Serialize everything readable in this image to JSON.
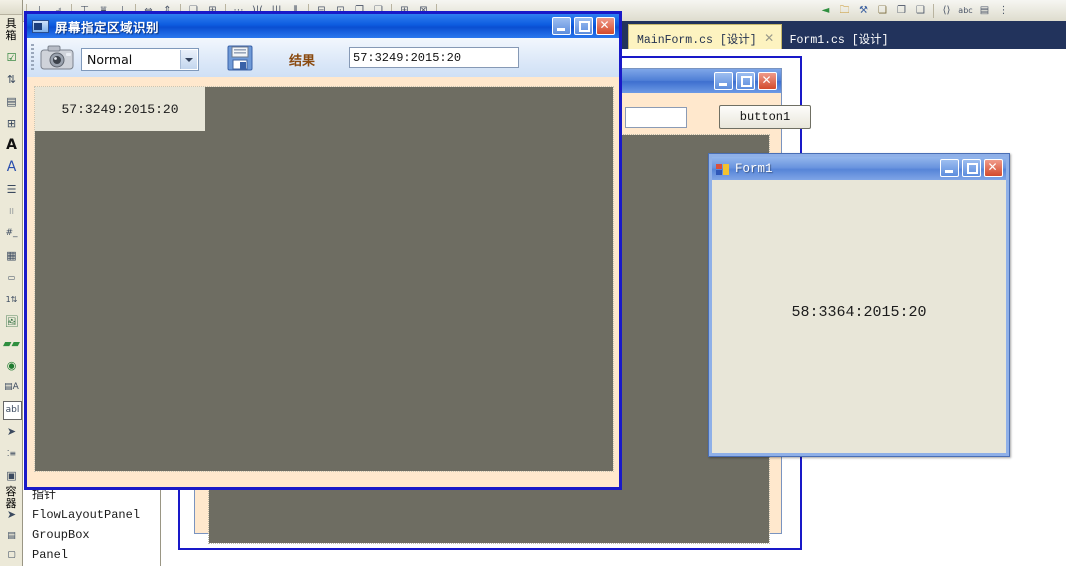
{
  "vs_toolbar": {
    "name": "visual-studio-layout-toolbar",
    "icons": [
      "align-lefts-icon",
      "align-centers-icon",
      "align-rights-icon",
      "align-tops-icon",
      "align-middles-icon",
      "align-bottoms-icon",
      "make-same-width-icon",
      "make-same-height-icon",
      "make-same-size-icon",
      "size-to-grid-icon",
      "horizontal-spacing-make-equal-icon",
      "horizontal-spacing-increase-icon",
      "horizontal-spacing-decrease-icon",
      "vertical-spacing-make-equal-icon",
      "center-horizontally-icon",
      "center-vertically-icon",
      "bring-to-front-icon",
      "send-to-back-icon",
      "tab-order-icon",
      "lock-controls-icon",
      "navigate-backward-icon",
      "open-file-icon",
      "find-in-files-icon",
      "replace-icon",
      "undo-checkout-icon",
      "redo-checkout-icon",
      "show-all-files-icon",
      "spell-check-icon",
      "properties-window-icon",
      "toolbar-overflow-icon"
    ]
  },
  "tabstrip": {
    "name": "document-tabs",
    "tabs": [
      {
        "label": "MainForm.cs [设计]",
        "active": true,
        "close_icon": "✕"
      },
      {
        "label": "Form1.cs [设计]",
        "active": false
      }
    ]
  },
  "toolbox": {
    "rail_title_top": "具箱",
    "rail_title_mid": "容器",
    "rail_icons": [
      "checkbox-control-icon",
      "numeric-updown-icon",
      "listview-control-icon",
      "datagridview-icon",
      "label-control-icon",
      "linklabel-control-icon",
      "listbox-control-icon",
      "checkedlistbox-icon",
      "maskedtextbox-icon",
      "monthcalendar-icon",
      "notifyicon-icon",
      "numericupdown-icon",
      "picturebox-icon",
      "progressbar-icon",
      "radiobutton-icon",
      "richtextbox-icon",
      "textbox-icon",
      "toolstrip-icon",
      "treeview-icon",
      "webbrowser-icon"
    ],
    "list_items": [
      {
        "label": "指针",
        "icon": "pointer-icon"
      },
      {
        "label": "FlowLayoutPanel",
        "icon": "flowlayoutpanel-icon"
      },
      {
        "label": "GroupBox",
        "icon": "groupbox-icon"
      },
      {
        "label": "Panel",
        "icon": "panel-icon"
      }
    ]
  },
  "background_designer": {
    "name": "mainform-designer-surface",
    "form": {
      "title": "",
      "min_label": "",
      "max_label": "",
      "close_label": "✕",
      "textbox_value": "",
      "button_label": "button1"
    }
  },
  "form1_window": {
    "name": "form1-runtime-window",
    "title": "Form1",
    "icon": "winforms-app-icon",
    "min_label": "",
    "max_label": "",
    "close_label": "✕",
    "result_text": "58:3364:2015:20"
  },
  "capture_window": {
    "name": "screen-region-ocr-window",
    "title": "屏幕指定区域识别",
    "icon": "screen-capture-icon",
    "min_label": "",
    "max_label": "",
    "close_label": "✕",
    "toolbar": {
      "camera_icon": "camera-icon",
      "mode_value": "Normal",
      "mode_options": [
        "Normal"
      ],
      "save_icon": "save-floppy-icon",
      "result_label": "结果",
      "result_value": "57:3249:2015:20",
      "result_placeholder": ""
    },
    "overlay_label": "57:3249:2015:20"
  },
  "colors": {
    "capture_border": "#1919c8",
    "canvas_gray": "#6e6d62",
    "form_cream": "#e8e6d8",
    "designer_peach": "#ffe8cd",
    "tab_active_bg": "#fdf3c0",
    "tabstrip_bg": "#22335c",
    "title_blue": "#0d5ce0",
    "form1_title_blue": "#6b95df",
    "toolbox_bg": "#ece9d8",
    "result_label_brown": "#8a4a10"
  }
}
